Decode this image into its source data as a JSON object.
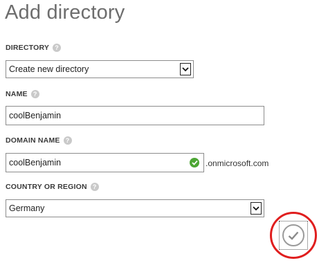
{
  "title": "Add directory",
  "directory": {
    "label": "DIRECTORY",
    "selected": "Create new directory"
  },
  "name": {
    "label": "NAME",
    "value": "coolBenjamin"
  },
  "domain_name": {
    "label": "DOMAIN NAME",
    "value": "coolBenjamin",
    "suffix": ".onmicrosoft.com",
    "status": "valid"
  },
  "country": {
    "label": "COUNTRY OR REGION",
    "selected": "Germany"
  },
  "icons": {
    "help": "help-icon",
    "help_glyph": "?",
    "valid": "checkmark-circle-icon",
    "dropdown": "chevron-down-icon",
    "confirm": "checkmark-icon"
  },
  "colors": {
    "title": "#6d6d6d",
    "valid_green": "#4da635",
    "annotation_red": "#e01e1e"
  }
}
